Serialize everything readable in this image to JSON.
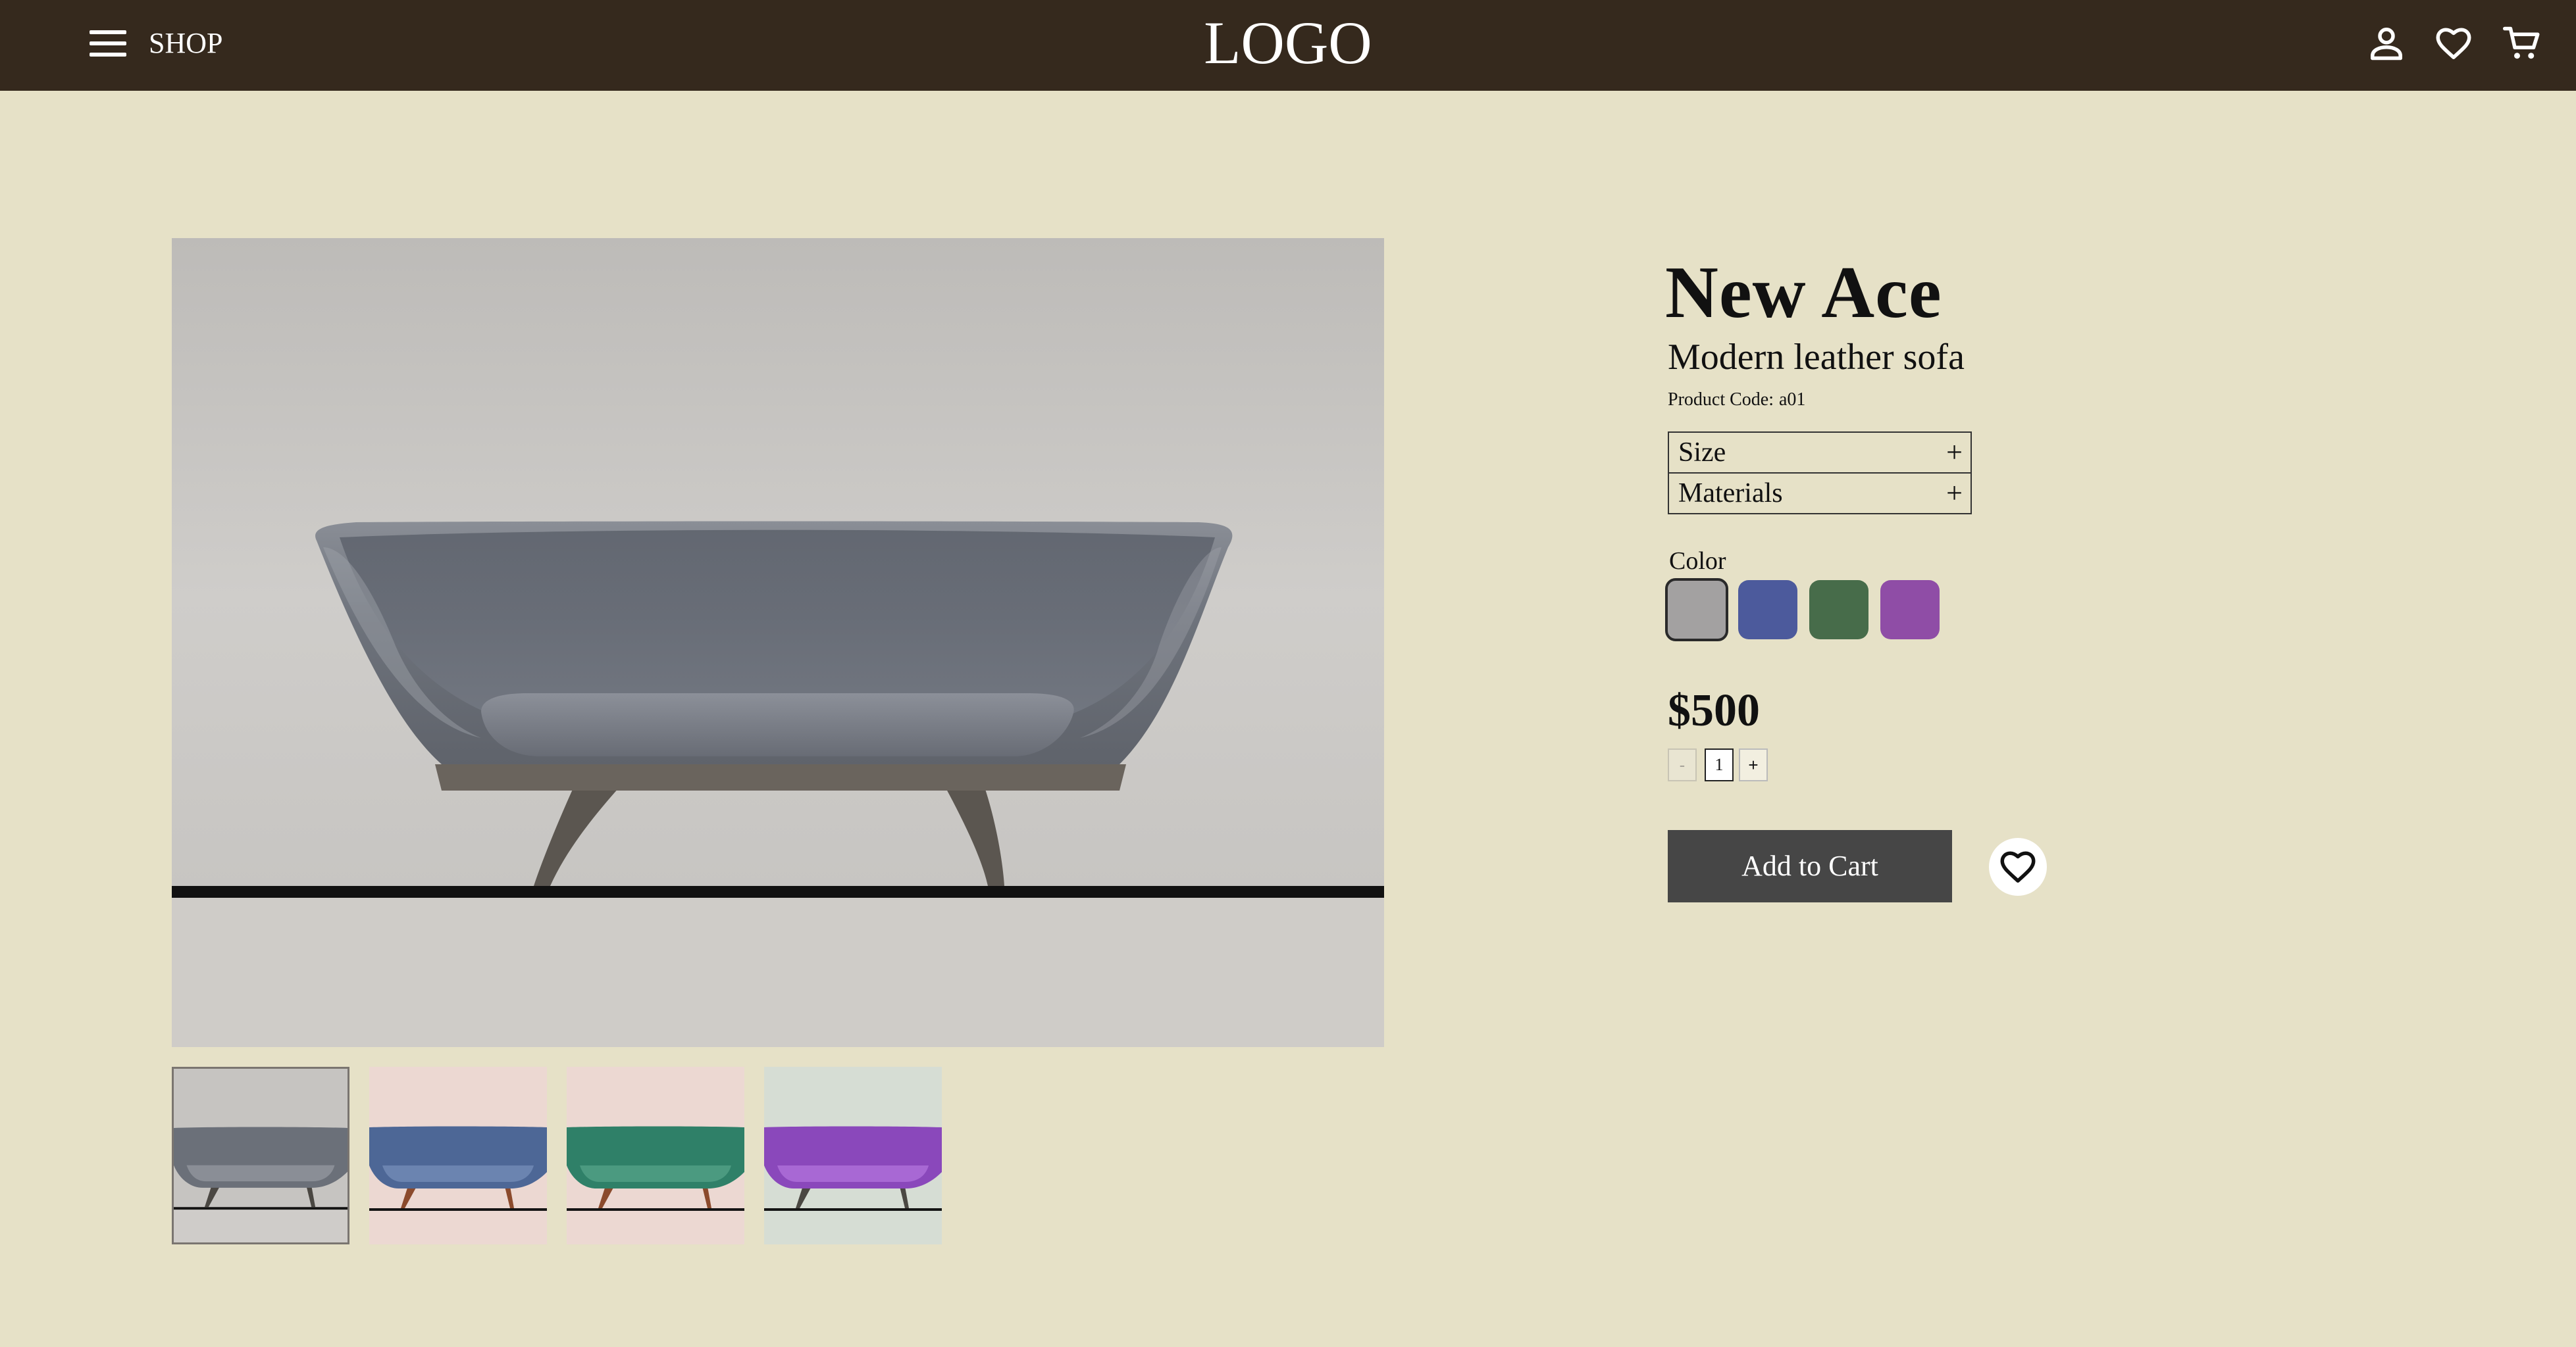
{
  "header": {
    "menu_label": "SHOP",
    "logo": "LOGO",
    "icons": [
      "menu-icon",
      "user-icon",
      "heart-icon",
      "cart-icon"
    ]
  },
  "gallery": {
    "main_image_alt": "grey sofa",
    "thumbnails": [
      {
        "name": "grey",
        "bg": "#cfccc9",
        "sofa": "#6b7079",
        "selected": true
      },
      {
        "name": "blue",
        "bg": "#ecd8d2",
        "sofa": "#4d6796",
        "selected": false
      },
      {
        "name": "green",
        "bg": "#ecd8d2",
        "sofa": "#2f8068",
        "selected": false
      },
      {
        "name": "purple",
        "bg": "#d6ddd4",
        "sofa": "#8a48bb",
        "selected": false
      }
    ]
  },
  "product": {
    "name": "New Ace",
    "subtitle": "Modern leather sofa",
    "code_label": "Product Code:",
    "code_value": "a01",
    "accordion": [
      {
        "label": "Size",
        "icon": "+"
      },
      {
        "label": "Materials",
        "icon": "+"
      }
    ],
    "color_label": "Color",
    "colors": [
      {
        "name": "grey",
        "hex": "#a3a1a1",
        "selected": true
      },
      {
        "name": "blue",
        "hex": "#4c5a9c",
        "selected": false
      },
      {
        "name": "green",
        "hex": "#476c4a",
        "selected": false
      },
      {
        "name": "purple",
        "hex": "#8f4da6",
        "selected": false
      }
    ],
    "price": "$500",
    "quantity": {
      "decrement": "-",
      "value": "1",
      "increment": "+"
    },
    "add_to_cart": "Add to Cart"
  },
  "colors": {
    "header_bg": "#35291d",
    "page_bg": "#e6e1c7",
    "button_bg": "#464646"
  }
}
